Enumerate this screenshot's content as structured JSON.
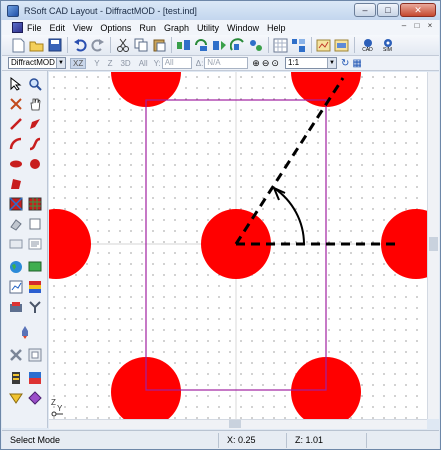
{
  "window": {
    "title": "RSoft CAD Layout - DiffractMOD - [test.ind]",
    "buttons": {
      "minimize": "–",
      "maximize": "□",
      "close": "✕"
    }
  },
  "menu": {
    "items": [
      "File",
      "Edit",
      "View",
      "Options",
      "Run",
      "Graph",
      "Utility",
      "Window",
      "Help"
    ],
    "mdi_buttons": [
      "–",
      "□",
      "×"
    ]
  },
  "toolbar": {
    "icons": [
      "new-file-icon",
      "open-folder-icon",
      "save-icon",
      "undo-icon",
      "redo-icon",
      "cut-icon",
      "copy-icon",
      "paste-icon",
      "tool-a-icon",
      "tool-b-icon",
      "tool-c-icon",
      "tool-d-icon",
      "tool-e-icon",
      "grid-icon",
      "tool-f-icon",
      "tool-g-icon",
      "cad-icon",
      "sim-icon"
    ],
    "labels": {
      "cad": "CAD",
      "sim": "SIM"
    }
  },
  "toolbar2": {
    "module_select": "DiffractMOD",
    "axes": [
      "XZ",
      "Y",
      "Z",
      "3D",
      "All"
    ],
    "y_label": "Y:",
    "y_value": "All",
    "delta_label": "Δ:",
    "delta_value": "N/A",
    "zoom_select": "1:1"
  },
  "canvas": {
    "axis_labels": {
      "z": "Z",
      "y": "Y"
    },
    "colors": {
      "circle_fill": "#ff0000",
      "cell_outline": "#a020a0",
      "grid_dot": "#606060"
    }
  },
  "statusbar": {
    "mode": "Select Mode",
    "x": "X: 0.25",
    "z": "Z: 1.01"
  }
}
